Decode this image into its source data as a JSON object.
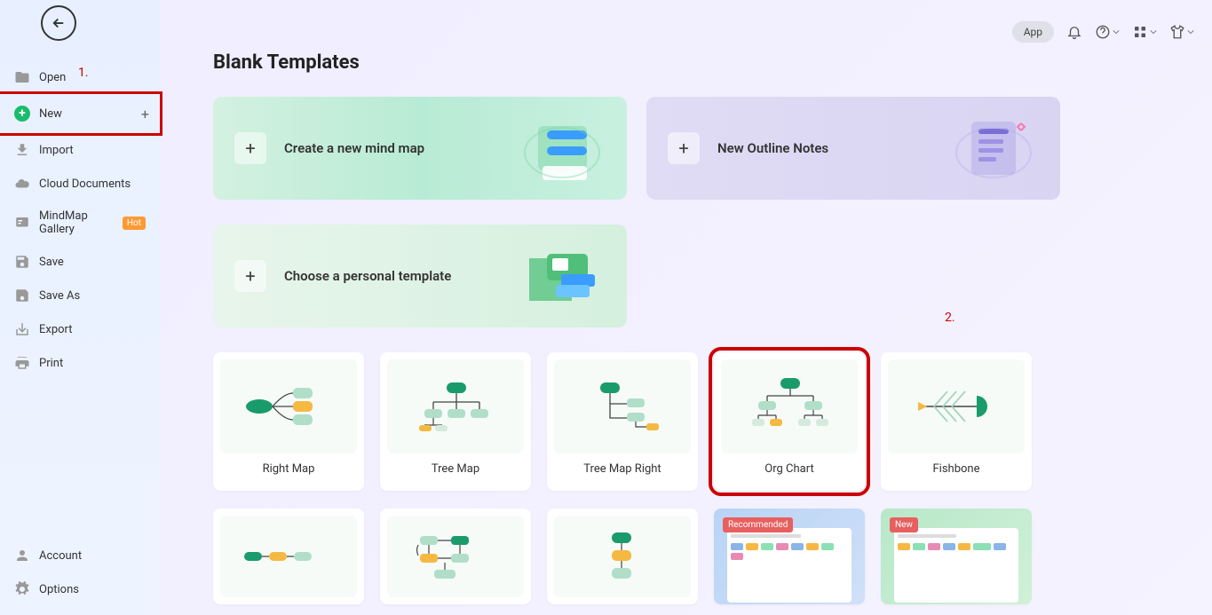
{
  "sidebar": {
    "items": [
      {
        "label": "Open",
        "icon": "folder"
      },
      {
        "label": "New",
        "icon": "plus-circle"
      },
      {
        "label": "Import",
        "icon": "import"
      },
      {
        "label": "Cloud Documents",
        "icon": "cloud"
      },
      {
        "label": "MindMap Gallery",
        "icon": "gallery",
        "badge": "Hot"
      },
      {
        "label": "Save",
        "icon": "save"
      },
      {
        "label": "Save As",
        "icon": "save-as"
      },
      {
        "label": "Export",
        "icon": "export"
      },
      {
        "label": "Print",
        "icon": "print"
      }
    ],
    "bottom": [
      {
        "label": "Account",
        "icon": "account"
      },
      {
        "label": "Options",
        "icon": "gear"
      }
    ]
  },
  "topbar": {
    "app": "App"
  },
  "page_title": "Blank Templates",
  "big_cards": {
    "mindmap": "Create a new mind map",
    "outline": "New Outline Notes",
    "template": "Choose a personal template"
  },
  "templates": [
    "Right Map",
    "Tree Map",
    "Tree Map Right",
    "Org Chart",
    "Fishbone"
  ],
  "badges": {
    "recommended": "Recommended",
    "new": "New"
  },
  "annotations": {
    "one": "1.",
    "two": "2."
  }
}
